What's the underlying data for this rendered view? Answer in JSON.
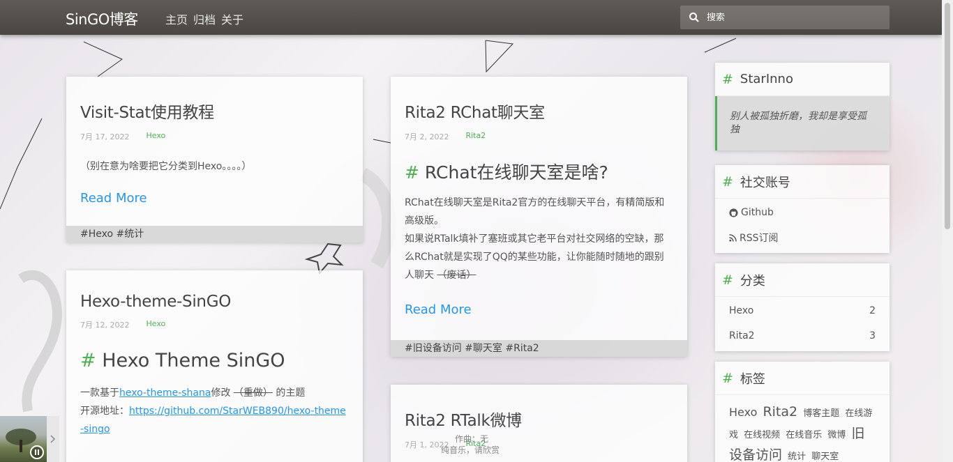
{
  "header": {
    "brand": "SinGO博客",
    "nav": [
      "主页",
      "归档",
      "关于"
    ],
    "search_placeholder": "搜索"
  },
  "posts": [
    {
      "title": "Visit-Stat使用教程",
      "date": "7月 17, 2022",
      "category": "Hexo",
      "excerpt": "（别在意为啥要把它分类到Hexo。。。。）",
      "read_more": "Read More",
      "tags": "#Hexo #统计"
    },
    {
      "title": "Rita2 RChat聊天室",
      "date": "7月 2, 2022",
      "category": "Rita2",
      "heading_hash": "#",
      "heading": "RChat在线聊天室是啥?",
      "para1": "RChat在线聊天室是Rita2官方的在线聊天平台，有精简版和高级版。",
      "para2_main": "如果说RTalk填补了塞班或其它老平台对社交网络的空缺，那么RChat就是实现了QQ的某些功能，让你能随时随地的跟别人聊天 ",
      "para2_strike": "（废话）",
      "read_more": "Read More",
      "tags": "#旧设备访问 #聊天室 #Rita2"
    },
    {
      "title": "Hexo-theme-SinGO",
      "date": "7月 12, 2022",
      "category": "Hexo",
      "heading_hash": "#",
      "heading": "Hexo Theme SinGO",
      "line1_a": "一款基于",
      "line1_link": "hexo-theme-shana",
      "line1_b": "修改 ",
      "line1_strike": "（重做）",
      "line1_c": " 的主题",
      "line2_label": "开源地址：",
      "line2_link": "https://github.com/StarWEB890/hexo-theme-singo"
    },
    {
      "title": "Rita2 RTalk微博",
      "date": "7月 1, 2022",
      "category": "Rita2"
    }
  ],
  "sidebar": {
    "about": {
      "hash": "#",
      "title": "StarInno",
      "quote": "别人被孤独折磨，我却是享受孤独"
    },
    "social": {
      "hash": "#",
      "title": "社交账号",
      "items": [
        "Github",
        "RSS订阅"
      ]
    },
    "categories": {
      "hash": "#",
      "title": "分类",
      "items": [
        {
          "name": "Hexo",
          "count": "2"
        },
        {
          "name": "Rita2",
          "count": "3"
        }
      ]
    },
    "tags": {
      "hash": "#",
      "title": "标签",
      "cloud": [
        "Hexo",
        "Rita2",
        "博客主题",
        "在线游戏",
        "在线视频",
        "在线音乐",
        "微博",
        "旧设备访问",
        "统计",
        "聊天室"
      ]
    }
  },
  "player": {
    "author": "作曲：无",
    "note": "纯音乐，请欣赏"
  },
  "colors": {
    "accent": "#4caf50",
    "link": "#2196f3",
    "navbar": "#524e4a"
  }
}
